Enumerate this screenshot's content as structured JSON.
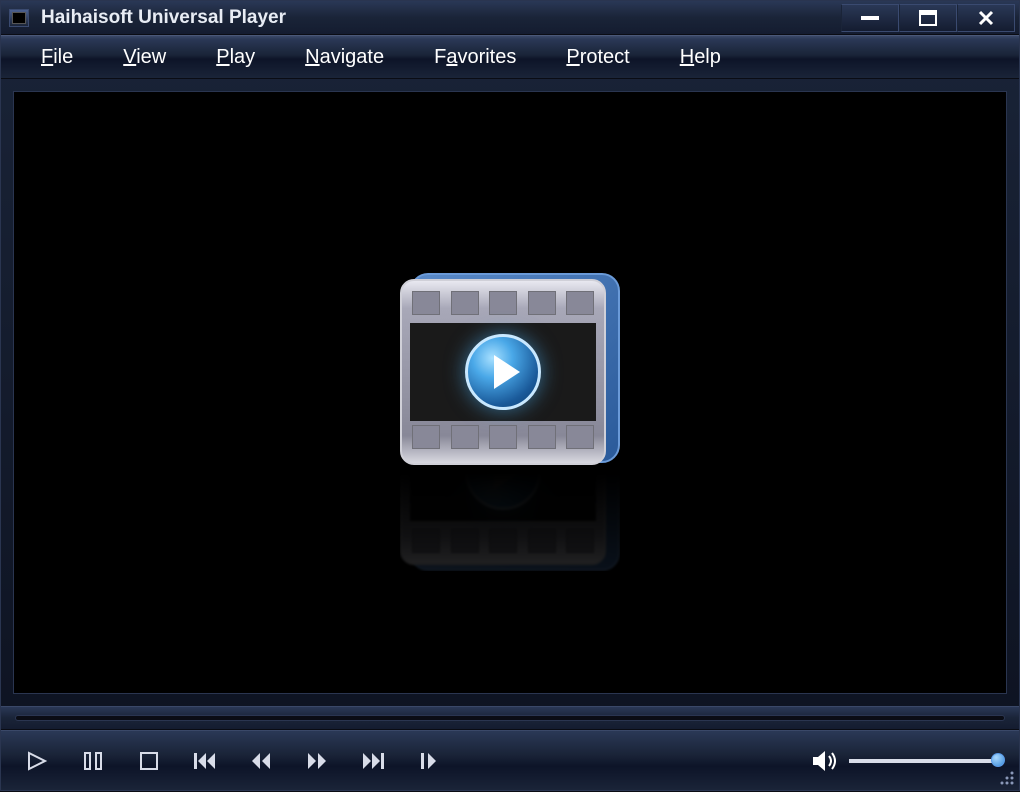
{
  "window": {
    "title": "Haihaisoft Universal Player"
  },
  "menubar": {
    "items": [
      {
        "label": "File",
        "accel": "F"
      },
      {
        "label": "View",
        "accel": "V"
      },
      {
        "label": "Play",
        "accel": "P"
      },
      {
        "label": "Navigate",
        "accel": "N"
      },
      {
        "label": "Favorites",
        "accel": "a"
      },
      {
        "label": "Protect",
        "accel": "P"
      },
      {
        "label": "Help",
        "accel": "H"
      }
    ]
  },
  "controls": {
    "volume_level": 100
  }
}
